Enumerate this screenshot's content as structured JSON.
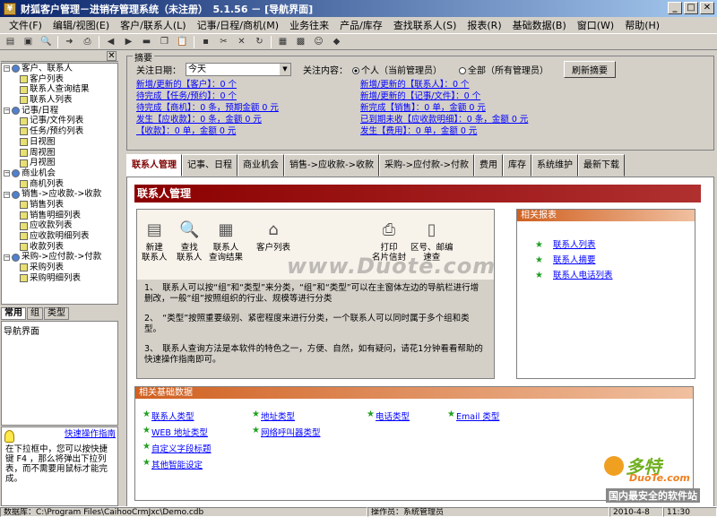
{
  "window": {
    "title": "财狐客户管理－进销存管理系统（未注册）　5.1.56 － [导航界面]"
  },
  "menu": [
    "文件(F)",
    "编辑/视图(E)",
    "客户/联系人(L)",
    "记事/日程/商机(M)",
    "业务往来",
    "产品/库存",
    "查找联系人(S)",
    "报表(R)",
    "基础数据(B)",
    "窗口(W)",
    "帮助(H)"
  ],
  "tree": [
    {
      "label": "客户、联系人",
      "lvl": 0,
      "icon": "globe"
    },
    {
      "label": "客户列表",
      "lvl": 1
    },
    {
      "label": "联系人查询结果",
      "lvl": 1
    },
    {
      "label": "联系人列表",
      "lvl": 1
    },
    {
      "label": "记事/日程",
      "lvl": 0,
      "icon": "globe"
    },
    {
      "label": "记事/文件列表",
      "lvl": 1
    },
    {
      "label": "任务/预约列表",
      "lvl": 1
    },
    {
      "label": "日视图",
      "lvl": 1
    },
    {
      "label": "周视图",
      "lvl": 1
    },
    {
      "label": "月视图",
      "lvl": 1
    },
    {
      "label": "商业机会",
      "lvl": 0,
      "icon": "globe"
    },
    {
      "label": "商机列表",
      "lvl": 1
    },
    {
      "label": "销售->应收款->收款",
      "lvl": 0,
      "icon": "globe"
    },
    {
      "label": "销售列表",
      "lvl": 1
    },
    {
      "label": "销售明细列表",
      "lvl": 1
    },
    {
      "label": "应收款列表",
      "lvl": 1
    },
    {
      "label": "应收款明细列表",
      "lvl": 1
    },
    {
      "label": "收款列表",
      "lvl": 1
    },
    {
      "label": "采购->应付款->付款",
      "lvl": 0,
      "icon": "globe"
    },
    {
      "label": "采购列表",
      "lvl": 1
    },
    {
      "label": "采购明细列表",
      "lvl": 1
    }
  ],
  "left_tabs": [
    "常用",
    "组",
    "类型"
  ],
  "nav_text": "导航界面",
  "help": {
    "link": "快速操作指南",
    "text": "在下拉框中，您可以按快捷键 F4 ，那么将弹出下拉列表，而不需要用鼠标才能完成。"
  },
  "summary": {
    "legend": "摘要",
    "date_label": "关注日期：",
    "date_value": "今天",
    "scope_label": "关注内容：",
    "radio1": "个人（当前管理员）",
    "radio2": "全部（所有管理员）",
    "refresh": "刷新摘要",
    "links": [
      "新增/更新的【客户】：0 个",
      "新增/更新的【联系人】：0 个",
      "待完成【任务/预约】：0 个",
      "新增/更新的【记事/文件】：0 个",
      "待完成【商机】：0 条，预期金额 0 元",
      "新完成【销售】：0 单，金额 0 元",
      "发生【应收款】：0 条，金额 0 元",
      "已到期未收【应收款明细】：0 条，金额 0 元",
      "【收款】：0 单，金额 0 元",
      "发生【费用】：0 单，金额 0 元"
    ]
  },
  "tabs": [
    "联系人管理",
    "记事、日程",
    "商业机会",
    "销售->应收款->收款",
    "采购->应付款->付款",
    "费用",
    "库存",
    "系统维护",
    "最新下载"
  ],
  "content": {
    "title": "联系人管理",
    "buttons": [
      {
        "l1": "新建",
        "l2": "联系人"
      },
      {
        "l1": "查找",
        "l2": "联系人"
      },
      {
        "l1": "联系人",
        "l2": "查询结果"
      },
      {
        "l1": "客户列表",
        "l2": ""
      },
      {
        "l1": "打印",
        "l2": "名片信封"
      },
      {
        "l1": "区号、邮编",
        "l2": "速查"
      }
    ],
    "notes": [
      "1、　联系人可以按“组”和“类型”来分类，“组”和“类型”可以在主窗体左边的导航栏进行增删改，一般“组”按照组织的行业、规模等进行分类",
      "2、　“类型”按照重要级别、紧密程度来进行分类，一个联系人可以同时属于多个组和类型。",
      "3、　联系人查询方法是本软件的特色之一，方便、自然，如有疑问，请花1分钟看看帮助的快速操作指南即可。"
    ],
    "related_reports_title": "相关报表",
    "reports": [
      "联系人列表",
      "联系人摘要",
      "联系人电话列表"
    ],
    "base_title": "相关基础数据",
    "base": [
      "联系人类型",
      "地址类型",
      "电话类型",
      "Email 类型",
      "WEB 地址类型",
      "网络呼叫器类型",
      "自定义字段标题",
      "其他智能设定"
    ]
  },
  "watermark": "www.Duote.com",
  "logo": {
    "t1": "多特",
    "t2": "DuoTe.com",
    "t3": "国内最安全的软件站"
  },
  "status": {
    "db": "数据库：C:\\Program Files\\CaihooCrmJxc\\Demo.cdb",
    "op": "操作员：系统管理员",
    "date": "2010-4-8",
    "time": "11:30"
  }
}
